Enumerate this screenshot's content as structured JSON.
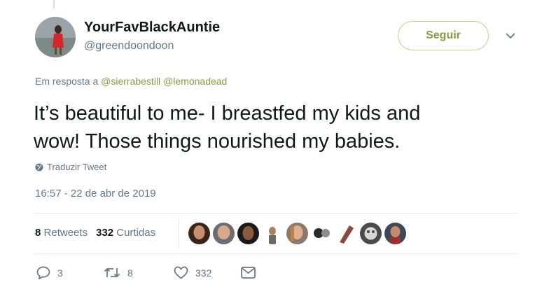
{
  "tweet": {
    "author": {
      "display_name": "YourFavBlackAuntie",
      "handle": "@greendoondoon",
      "avatar_icon": "avatar-photo"
    },
    "follow_label": "Seguir",
    "reply_prefix": "Em resposta a",
    "reply_mentions": [
      "@sierrabestill",
      "@lemonadead"
    ],
    "text_lines": [
      "It’s beautiful to me- I breastfed my kids and",
      "wow! Those things nourished my babies."
    ],
    "translate_label": "Traduzir Tweet",
    "timestamp": "16:57 - 22 de abr de 2019",
    "stats": {
      "retweets_count": "8",
      "retweets_label": "Retweets",
      "likes_count": "332",
      "likes_label": "Curtidas"
    },
    "liker_count": 9,
    "actions": {
      "reply_count": "3",
      "retweet_count": "8",
      "like_count": "332"
    }
  },
  "colors": {
    "accent": "#8c9a3c",
    "muted": "#657786",
    "text": "#14171a",
    "border": "#e6ecf0"
  }
}
